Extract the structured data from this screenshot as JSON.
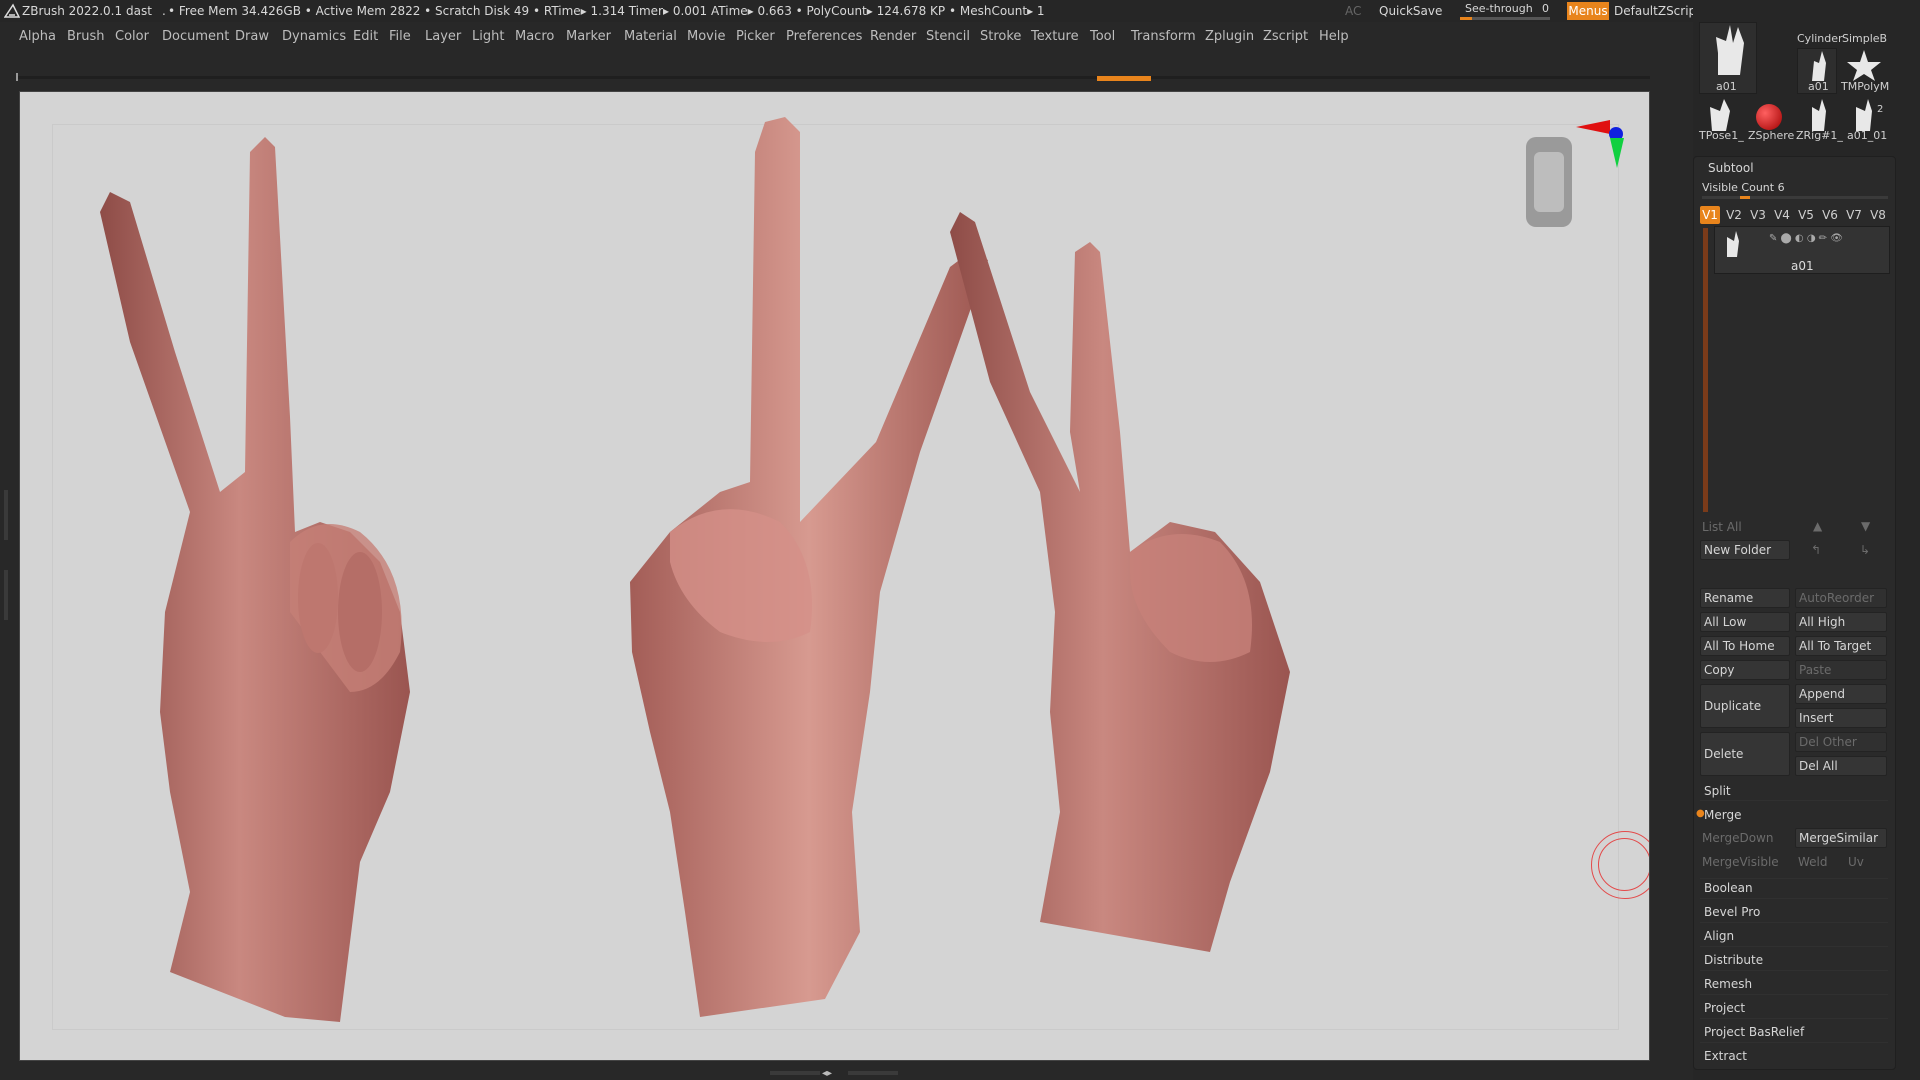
{
  "titlebar": {
    "app": "ZBrush 2022.0.1",
    "file": "dast",
    "stats": "• Free Mem 34.426GB • Active Mem 2822 • Scratch Disk 49 •  RTime▸ 1.314 Timer▸ 0.001 ATime▸ 0.663 • PolyCount▸ 124.678 KP  • MeshCount▸ 1",
    "ac": "AC",
    "quicksave": "QuickSave",
    "see_through_label": "See-through",
    "see_through_value": "0",
    "menus": "Menus",
    "default_zscript": "DefaultZScript"
  },
  "menubar": [
    "Alpha",
    "Brush",
    "Color",
    "Document",
    "Draw",
    "Dynamics",
    "Edit",
    "File",
    "Layer",
    "Light",
    "Macro",
    "Marker",
    "Material",
    "Movie",
    "Picker",
    "Preferences",
    "Render",
    "Stencil",
    "Stroke",
    "Texture",
    "Tool",
    "Transform",
    "Zplugin",
    "Zscript",
    "Help"
  ],
  "tool_thumbs": {
    "top_labels": [
      "Cylinder",
      "SimpleB"
    ],
    "row1": [
      "a01",
      "a01",
      "TMPolyM"
    ],
    "row2": [
      "TPose1_",
      "ZSphere",
      "ZRig#1_",
      "a01_01"
    ],
    "badge": "2"
  },
  "subtool": {
    "title": "Subtool",
    "visible_count": "Visible Count 6",
    "tabs": [
      "V1",
      "V2",
      "V3",
      "V4",
      "V5",
      "V6",
      "V7",
      "V8"
    ],
    "active_tab": "V1",
    "item_name": "a01",
    "list_all": "List All",
    "new_folder": "New Folder",
    "rename": "Rename",
    "auto_reorder": "AutoReorder",
    "all_low": "All Low",
    "all_high": "All High",
    "all_to_home": "All To Home",
    "all_to_target": "All To Target",
    "copy": "Copy",
    "paste": "Paste",
    "duplicate": "Duplicate",
    "append": "Append",
    "insert": "Insert",
    "delete": "Delete",
    "del_other": "Del Other",
    "del_all": "Del All",
    "split": "Split",
    "merge": "Merge",
    "merge_down": "MergeDown",
    "merge_similar": "MergeSimilar",
    "merge_visible": "MergeVisible",
    "weld": "Weld",
    "uv": "Uv",
    "sections": [
      "Boolean",
      "Bevel Pro",
      "Align",
      "Distribute",
      "Remesh",
      "Project",
      "Project BasRelief",
      "Extract"
    ]
  },
  "colors": {
    "accent": "#e8841c",
    "canvas_bg": "#d4d4d4",
    "skin": "#b06a64"
  }
}
